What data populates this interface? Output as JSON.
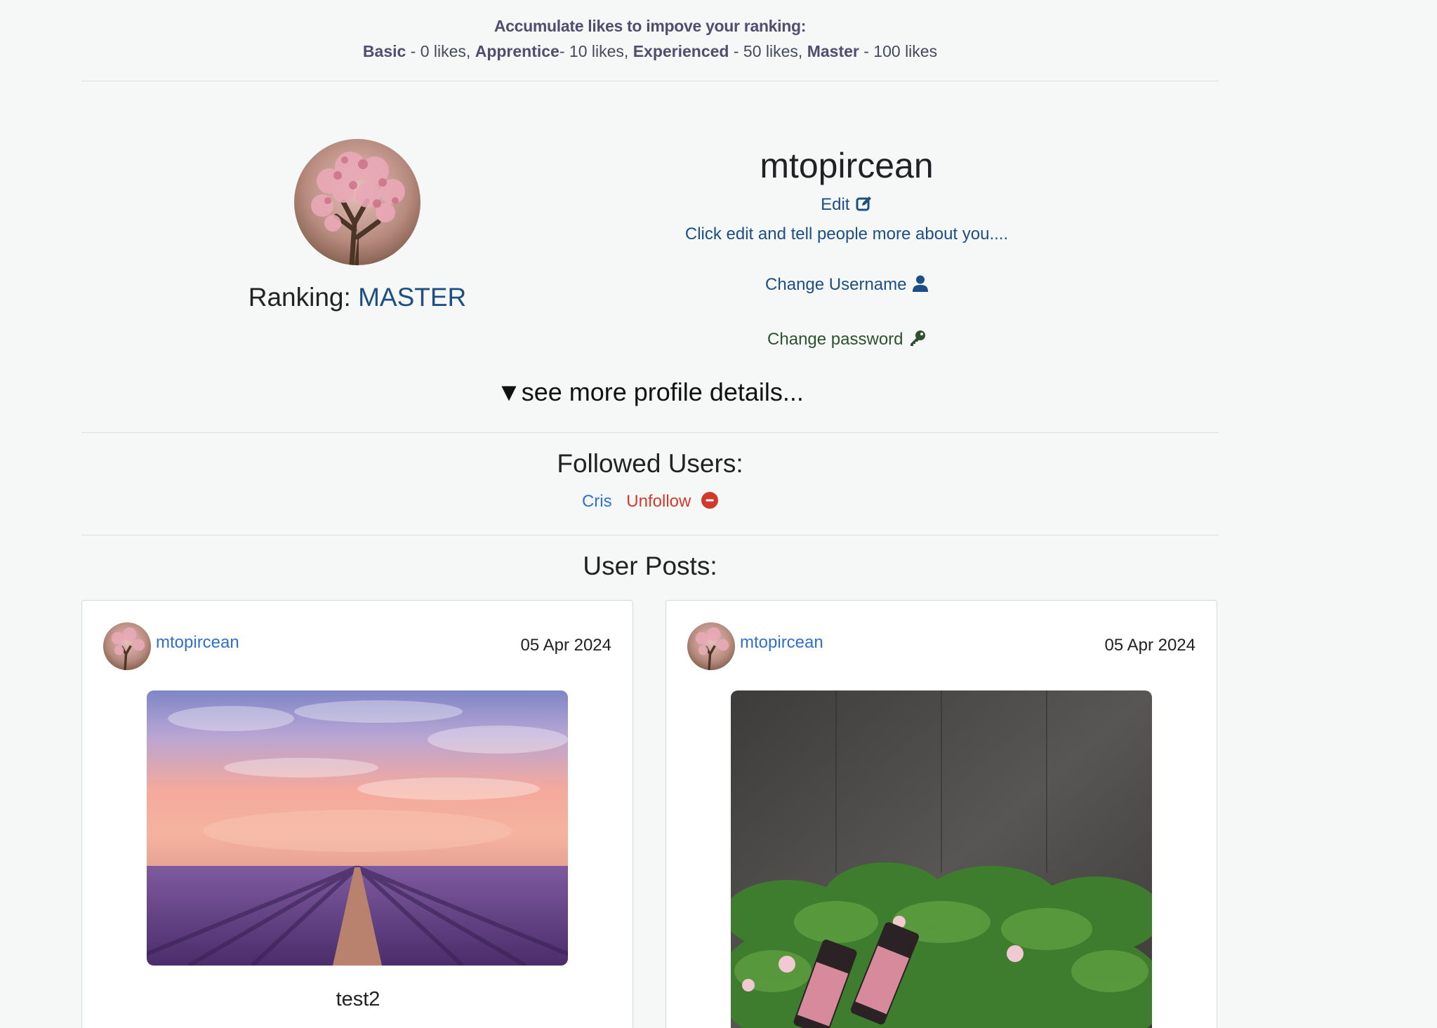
{
  "ranking_info": {
    "title": "Accumulate likes to impove your ranking:",
    "levels": [
      {
        "name": "Basic",
        "rest": " - 0 likes, "
      },
      {
        "name": "Apprentice",
        "rest": "- 10 likes, "
      },
      {
        "name": "Experienced",
        "rest": " - 50 likes, "
      },
      {
        "name": "Master",
        "rest": " - 100 likes"
      }
    ]
  },
  "profile": {
    "username": "mtopircean",
    "ranking_label": "Ranking: ",
    "ranking_value": "MASTER",
    "edit_label": "Edit",
    "about_text": "Click edit and tell people more about you....",
    "change_username_label": "Change Username",
    "change_password_label": "Change password",
    "see_more_label": "▼see more profile details..."
  },
  "followed": {
    "title": "Followed Users:",
    "users": [
      {
        "name": "Cris",
        "action": "Unfollow"
      }
    ]
  },
  "posts": {
    "title": "User Posts:",
    "items": [
      {
        "author": "mtopircean",
        "date": "05 Apr 2024",
        "caption": "test2",
        "image": "lavender-field-sunset"
      },
      {
        "author": "mtopircean",
        "date": "05 Apr 2024",
        "caption": "",
        "image": "geranium-essential-oils"
      }
    ]
  },
  "colors": {
    "link_blue": "#1d4e84",
    "accent_blue": "#2f6fcf",
    "danger_red": "#d03a2c",
    "key_green": "#2c5130",
    "background": "#f6f8f7"
  },
  "icons": {
    "edit": "edit-icon",
    "user": "user-icon",
    "key": "key-icon",
    "unfollow": "minus-circle-icon"
  }
}
